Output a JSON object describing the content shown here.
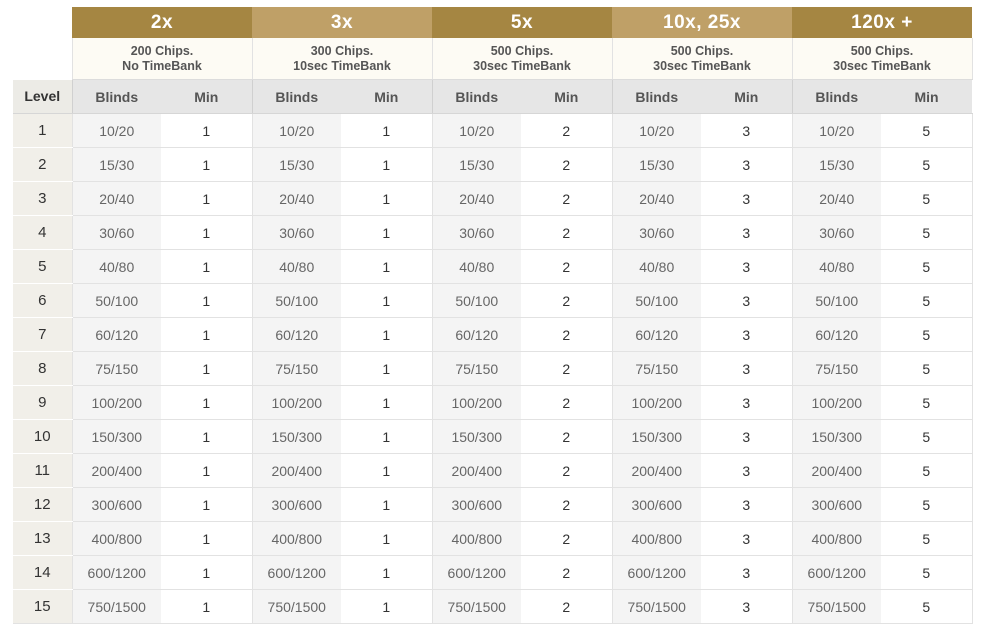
{
  "table": {
    "level_header": "Level",
    "blinds_header": "Blinds",
    "min_header": "Min",
    "groups": [
      {
        "multiplier": "2x",
        "chips": "200 Chips.",
        "timebank": "No TimeBank",
        "min": "1"
      },
      {
        "multiplier": "3x",
        "chips": "300 Chips.",
        "timebank": "10sec TimeBank",
        "min": "1"
      },
      {
        "multiplier": "5x",
        "chips": "500 Chips.",
        "timebank": "30sec TimeBank",
        "min": "2"
      },
      {
        "multiplier": "10x, 25x",
        "chips": "500 Chips.",
        "timebank": "30sec TimeBank",
        "min": "3"
      },
      {
        "multiplier": "120x +",
        "chips": "500 Chips.",
        "timebank": "30sec TimeBank",
        "min": "5"
      }
    ],
    "rows": [
      {
        "level": "1",
        "blinds": "10/20"
      },
      {
        "level": "2",
        "blinds": "15/30"
      },
      {
        "level": "3",
        "blinds": "20/40"
      },
      {
        "level": "4",
        "blinds": "30/60"
      },
      {
        "level": "5",
        "blinds": "40/80"
      },
      {
        "level": "6",
        "blinds": "50/100"
      },
      {
        "level": "7",
        "blinds": "60/120"
      },
      {
        "level": "8",
        "blinds": "75/150"
      },
      {
        "level": "9",
        "blinds": "100/200"
      },
      {
        "level": "10",
        "blinds": "150/300"
      },
      {
        "level": "11",
        "blinds": "200/400"
      },
      {
        "level": "12",
        "blinds": "300/600"
      },
      {
        "level": "13",
        "blinds": "400/800"
      },
      {
        "level": "14",
        "blinds": "600/1200"
      },
      {
        "level": "15",
        "blinds": "750/1500"
      }
    ]
  },
  "colors": {
    "header_dark": "#a58642",
    "header_light": "#bfa067"
  }
}
